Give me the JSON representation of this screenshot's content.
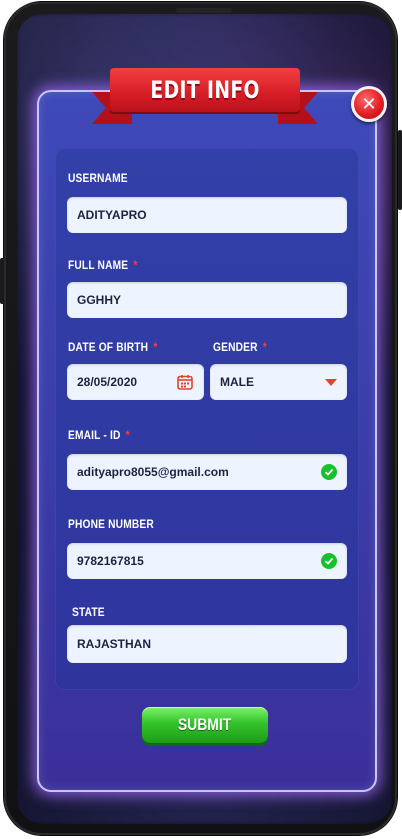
{
  "dialog": {
    "title": "EDIT INFO",
    "close_label": "✕",
    "submit_label": "SUBMIT"
  },
  "fields": {
    "username": {
      "label": "USERNAME",
      "value": "ADITYAPRO"
    },
    "full_name": {
      "label": "FULL NAME",
      "value": "GGHHY",
      "required_mark": "*"
    },
    "dob": {
      "label": "DATE OF BIRTH",
      "value": "28/05/2020",
      "required_mark": "*"
    },
    "gender": {
      "label": "GENDER",
      "value": "MALE",
      "required_mark": "*"
    },
    "email": {
      "label": "EMAIL - ID",
      "value": "adityapro8055@gmail.com",
      "required_mark": "*"
    },
    "phone": {
      "label": "PHONE NUMBER",
      "value": "9782167815"
    },
    "state": {
      "label": "STATE",
      "value": "RAJASTHAN"
    }
  },
  "icons": {
    "close": "close-icon",
    "calendar": "calendar-icon",
    "dropdown": "chevron-down-icon",
    "verified": "check-circle-icon"
  },
  "colors": {
    "panel": "#3a3ca8",
    "ribbon": "#d51d26",
    "submit": "#34c32a",
    "verified": "#17c12b",
    "required": "#ff3b3b"
  }
}
